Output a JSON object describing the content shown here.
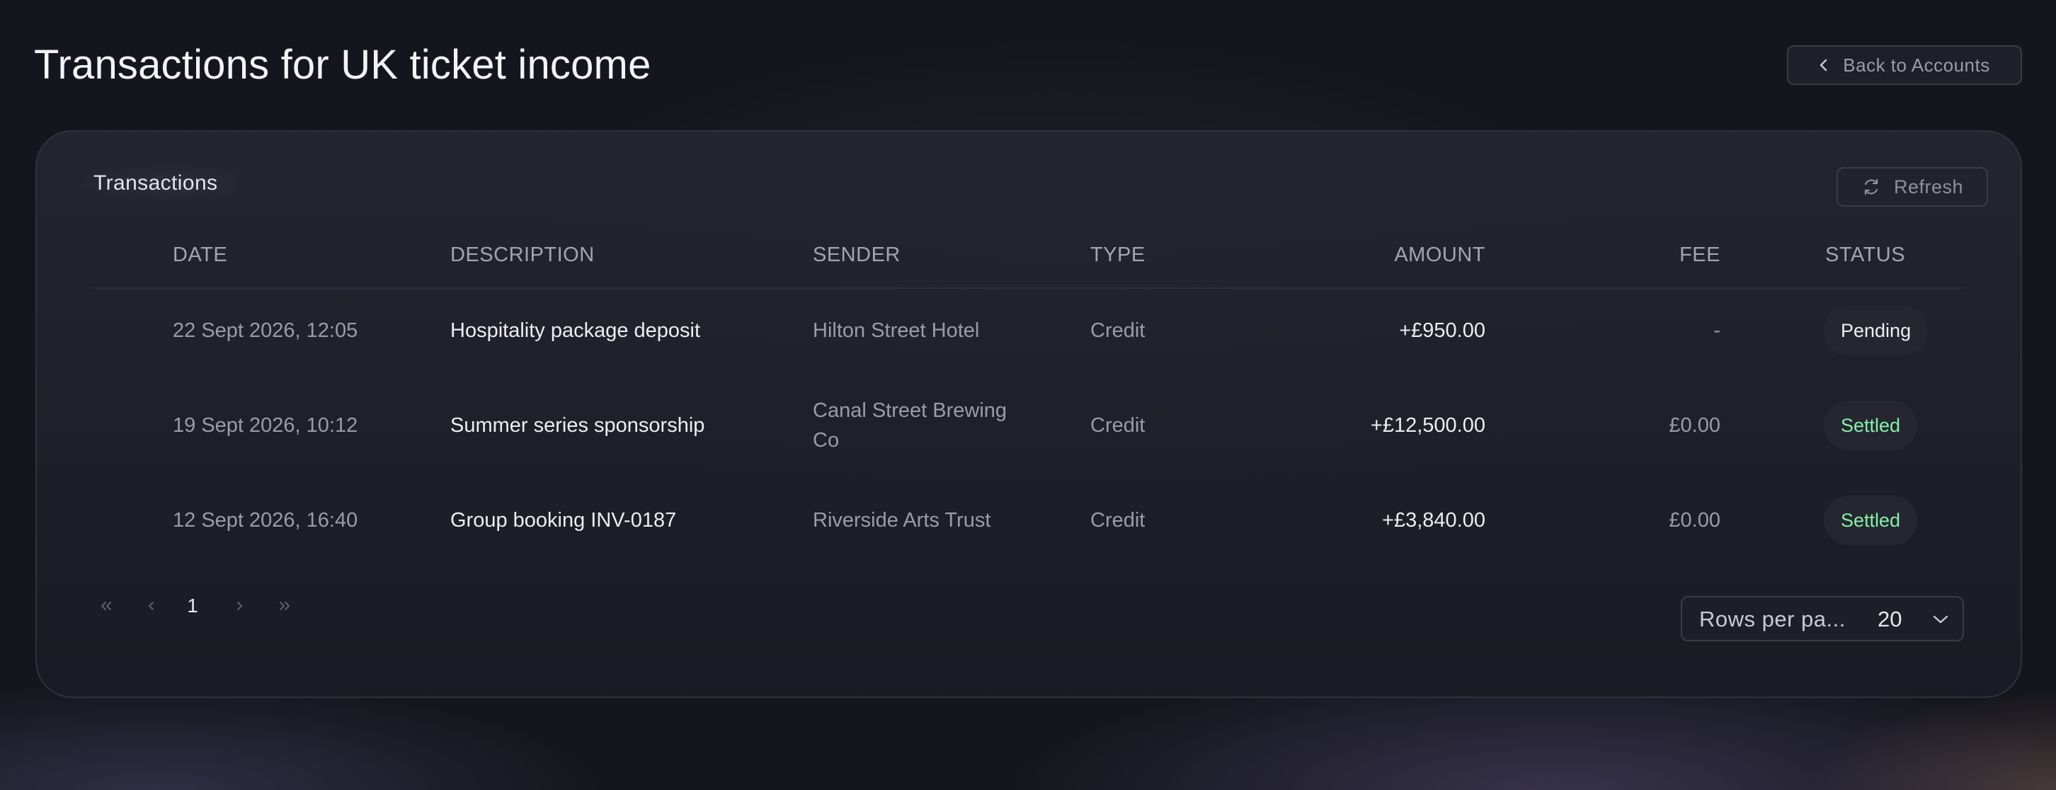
{
  "page": {
    "title": "Transactions for UK ticket income",
    "back_label": "Back to Accounts"
  },
  "card": {
    "title": "Transactions",
    "refresh_label": "Refresh"
  },
  "table": {
    "headers": {
      "date": "DATE",
      "description": "DESCRIPTION",
      "sender": "SENDER",
      "type": "TYPE",
      "amount": "AMOUNT",
      "fee": "FEE",
      "status": "STATUS"
    },
    "rows": [
      {
        "date": "22 Sept 2026, 12:05",
        "description": "Hospitality package deposit",
        "sender": "Hilton Street Hotel",
        "type": "Credit",
        "amount": "+£950.00",
        "fee": "-",
        "status": "Pending"
      },
      {
        "date": "19 Sept 2026, 10:12",
        "description": "Summer series sponsorship",
        "sender": "Canal Street Brewing Co",
        "type": "Credit",
        "amount": "+£12,500.00",
        "fee": "£0.00",
        "status": "Settled"
      },
      {
        "date": "12 Sept 2026, 16:40",
        "description": "Group booking INV-0187",
        "sender": "Riverside Arts Trust",
        "type": "Credit",
        "amount": "+£3,840.00",
        "fee": "£0.00",
        "status": "Settled"
      }
    ]
  },
  "pagination": {
    "current_page": "1",
    "rows_per_page_label": "Rows per pa...",
    "rows_per_page_value": "20"
  },
  "icons": {
    "back": "chevron-left-icon",
    "refresh": "refresh-icon",
    "first": "chevrons-left-icon",
    "prev": "chevron-left-icon",
    "next": "chevron-right-icon",
    "last": "chevrons-right-icon",
    "dropdown": "chevron-down-icon"
  },
  "colors": {
    "background": "#15161d",
    "pending_text": "#eceef2",
    "settled_text": "#86efac",
    "badge_bg": "#25262f"
  }
}
